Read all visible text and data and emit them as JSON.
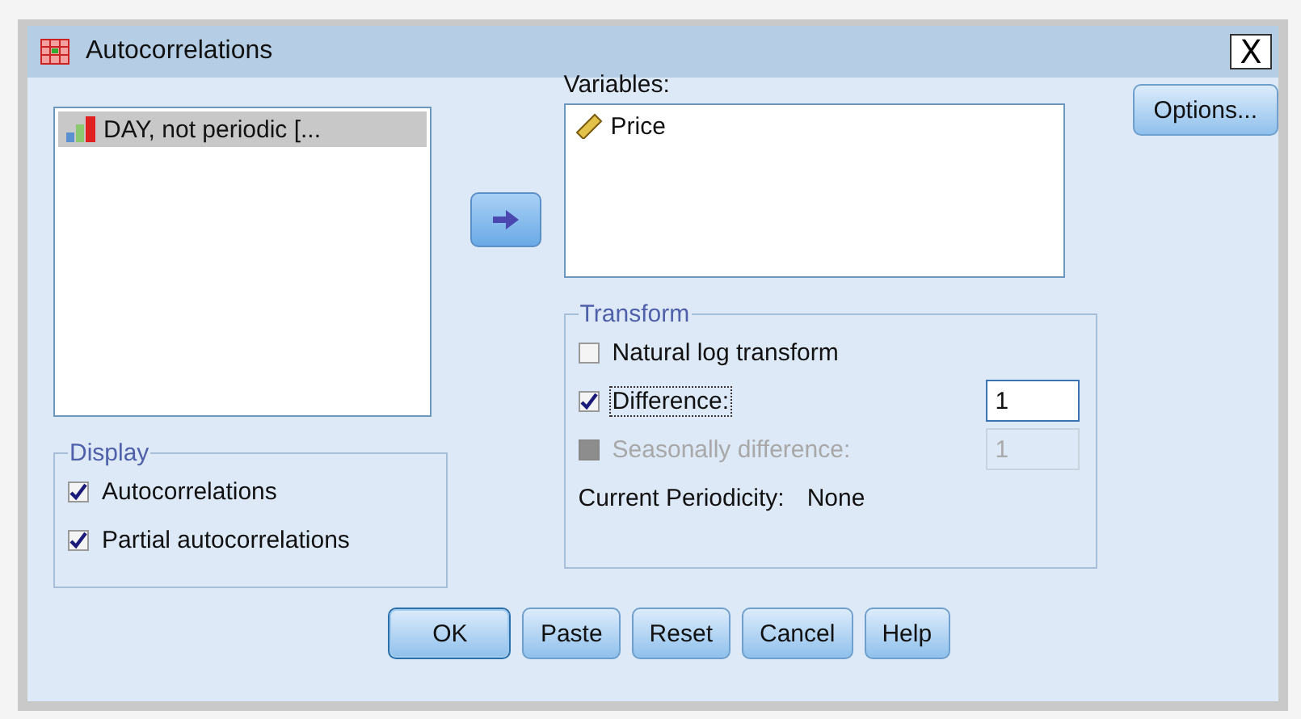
{
  "window": {
    "title": "Autocorrelations",
    "close": "X"
  },
  "source_list": {
    "items": [
      {
        "label": "DAY, not periodic [...",
        "selected": true
      }
    ]
  },
  "move_button": {
    "disabled": false
  },
  "variables": {
    "label": "Variables:",
    "items": [
      {
        "label": "Price",
        "selected": false
      }
    ]
  },
  "options_button": "Options...",
  "display": {
    "title": "Display",
    "options": [
      {
        "label": "Autocorrelations",
        "checked": true
      },
      {
        "label": "Partial autocorrelations",
        "checked": true
      }
    ]
  },
  "transform": {
    "title": "Transform",
    "options": [
      {
        "label": "Natural log transform",
        "checked": false,
        "disabled": false,
        "focused": false
      },
      {
        "label": "Difference:",
        "checked": true,
        "disabled": false,
        "focused": true,
        "value": "1"
      },
      {
        "label": "Seasonally difference:",
        "checked": false,
        "disabled": true,
        "focused": false,
        "value": "1"
      }
    ],
    "periodicity_label": "Current Periodicity:",
    "periodicity_value": "None"
  },
  "buttons": [
    {
      "label": "OK",
      "default": true
    },
    {
      "label": "Paste",
      "default": false
    },
    {
      "label": "Reset",
      "default": false
    },
    {
      "label": "Cancel",
      "default": false
    },
    {
      "label": "Help",
      "default": false
    }
  ]
}
